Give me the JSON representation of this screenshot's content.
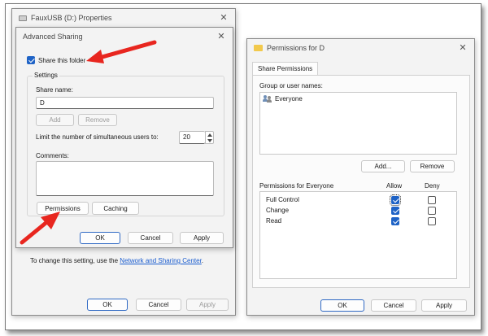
{
  "properties_window": {
    "title": "FauxUSB (D:) Properties",
    "hint_prefix": "To change this setting, use the ",
    "hint_link": "Network and Sharing Center",
    "hint_suffix": ".",
    "ok_label": "OK",
    "cancel_label": "Cancel",
    "apply_label": "Apply"
  },
  "advanced_sharing": {
    "title": "Advanced Sharing",
    "share_checkbox_label": "Share this folder",
    "share_checked": true,
    "settings_legend": "Settings",
    "share_name_label": "Share name:",
    "share_name_value": "D",
    "add_label": "Add",
    "remove_label": "Remove",
    "limit_label": "Limit the number of simultaneous users to:",
    "limit_value": "20",
    "comments_label": "Comments:",
    "permissions_label": "Permissions",
    "caching_label": "Caching",
    "ok_label": "OK",
    "cancel_label": "Cancel",
    "apply_label": "Apply"
  },
  "permissions_dialog": {
    "title": "Permissions for D",
    "tab_label": "Share Permissions",
    "group_label": "Group or user names:",
    "users": [
      "Everyone"
    ],
    "add_label": "Add...",
    "remove_label": "Remove",
    "perm_header": "Permissions for Everyone",
    "allow_header": "Allow",
    "deny_header": "Deny",
    "permissions": [
      {
        "name": "Full Control",
        "allow": true,
        "deny": false
      },
      {
        "name": "Change",
        "allow": true,
        "deny": false
      },
      {
        "name": "Read",
        "allow": true,
        "deny": false
      }
    ],
    "ok_label": "OK",
    "cancel_label": "Cancel",
    "apply_label": "Apply"
  },
  "colors": {
    "accent": "#1f63c6",
    "annotation_arrow": "#e8261f",
    "folder": "#f2c94c"
  }
}
